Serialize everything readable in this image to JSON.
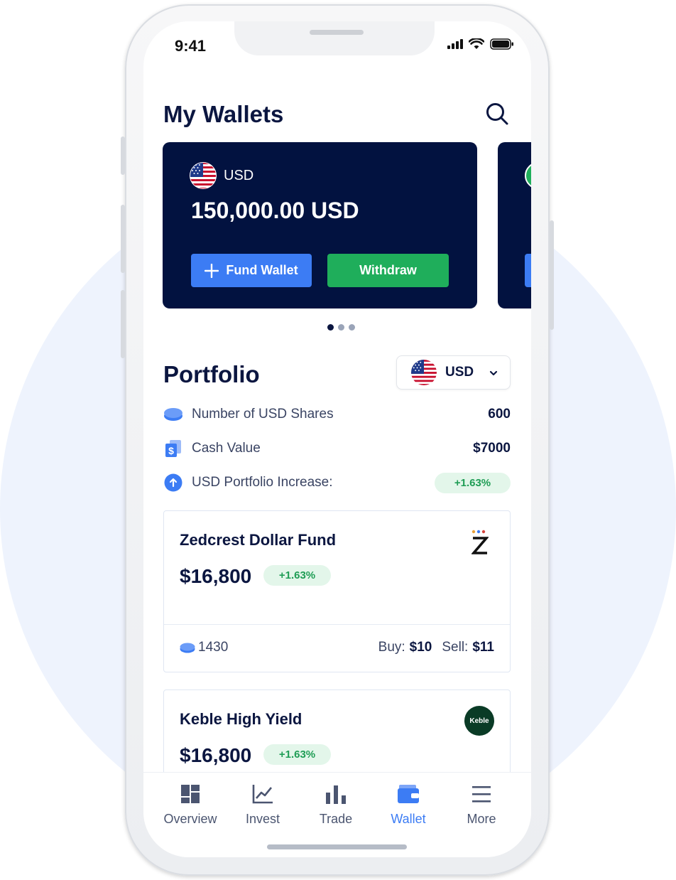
{
  "status_bar": {
    "time": "9:41"
  },
  "header": {
    "title": "My Wallets"
  },
  "wallet_card": {
    "currency": "USD",
    "balance": "150,000.00 USD",
    "fund_label": "Fund Wallet",
    "withdraw_label": "Withdraw"
  },
  "carousel": {
    "pages": 3,
    "active": 1
  },
  "portfolio": {
    "title": "Portfolio",
    "selected_currency": "USD",
    "stats": [
      {
        "label": "Number of USD Shares",
        "value": "600",
        "icon": "coins-icon"
      },
      {
        "label": "Cash Value",
        "value": "$7000",
        "icon": "cash-icon"
      },
      {
        "label": "USD Portfolio Increase:",
        "value": "+1.63%",
        "icon": "arrow-up-icon"
      }
    ]
  },
  "funds": [
    {
      "name": "Zedcrest Dollar Fund",
      "price": "$16,800",
      "change": "+1.63%",
      "units": "1430",
      "buy_label": "Buy:",
      "buy_value": "$10",
      "sell_label": "Sell:",
      "sell_value": "$11",
      "logo": "zedcrest-logo"
    },
    {
      "name": "Keble High Yield",
      "price": "$16,800",
      "change": "+1.63%",
      "logo": "keble-logo",
      "logo_text": "Keble"
    }
  ],
  "tabbar": {
    "items": [
      {
        "label": "Overview",
        "icon": "overview-icon"
      },
      {
        "label": "Invest",
        "icon": "chart-line-icon"
      },
      {
        "label": "Trade",
        "icon": "bar-chart-icon"
      },
      {
        "label": "Wallet",
        "icon": "wallet-icon",
        "active": true
      },
      {
        "label": "More",
        "icon": "menu-icon"
      }
    ]
  },
  "colors": {
    "navy": "#021240",
    "accent_blue": "#3c7cf4",
    "green": "#1fae5b",
    "pill_green_bg": "#e3f6ea",
    "background_circle": "#eef3fd"
  }
}
